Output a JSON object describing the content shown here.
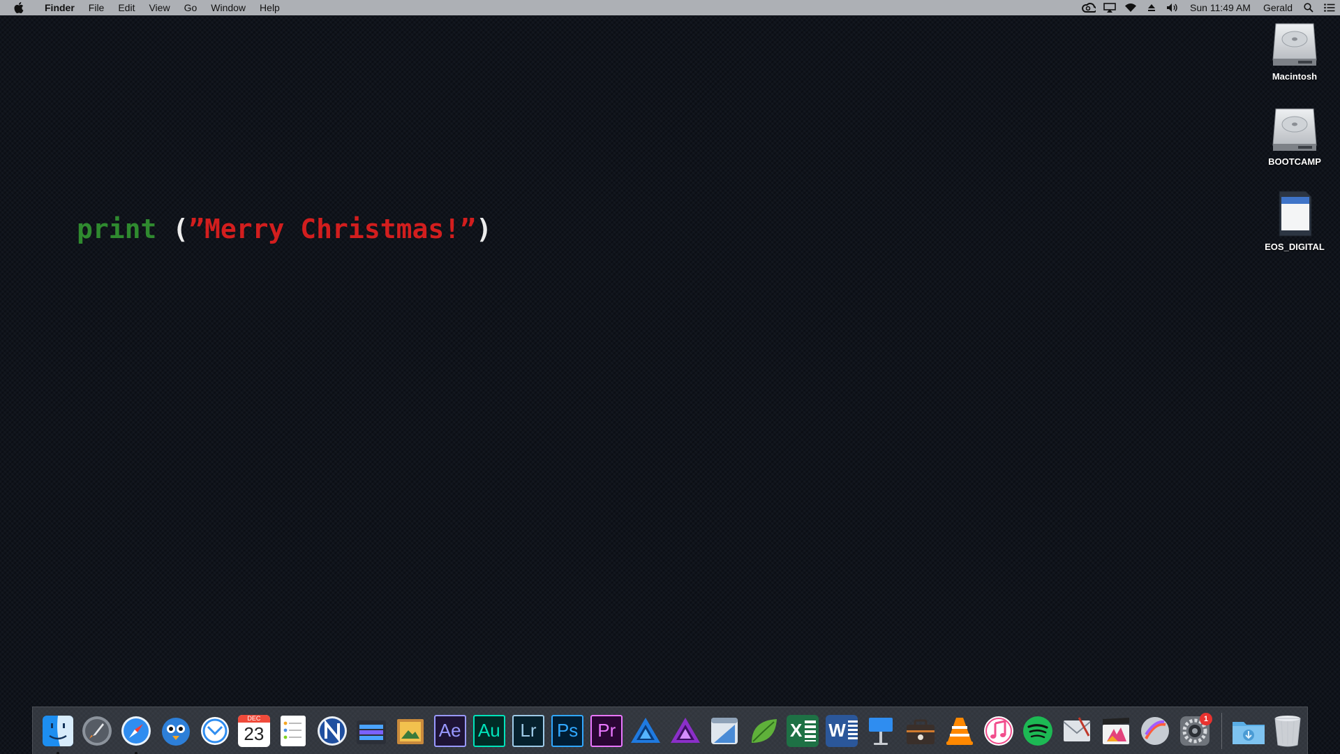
{
  "menubar": {
    "app": "Finder",
    "items": [
      "File",
      "Edit",
      "View",
      "Go",
      "Window",
      "Help"
    ],
    "clock": "Sun 11:49 AM",
    "user": "Gerald",
    "status_icons": [
      "creative-cloud-icon",
      "airplay-icon",
      "wifi-icon",
      "eject-icon",
      "volume-icon",
      "spotlight-icon",
      "notification-center-icon"
    ]
  },
  "desktop": {
    "code": {
      "keyword": "print",
      "open": " (",
      "string": "”Merry Christmas!”",
      "close": ")"
    },
    "icons": [
      {
        "label": "Macintosh",
        "type": "hard-drive-icon"
      },
      {
        "label": "BOOTCAMP",
        "type": "hard-drive-icon"
      },
      {
        "label": "EOS_DIGITAL",
        "type": "sd-card-icon"
      }
    ]
  },
  "dock": {
    "calendar": {
      "month": "DEC",
      "day": "23"
    },
    "adobe": {
      "ae": "Ae",
      "au": "Au",
      "lr": "Lr",
      "ps": "Ps",
      "pr": "Pr"
    },
    "excel_letter": "X",
    "word_letter": "W",
    "system_prefs_badge": "1",
    "colors": {
      "ae": "#9999ff",
      "au": "#00e4bb",
      "lr": "#31a8ff",
      "ps": "#31a8ff",
      "pr": "#ea77ff",
      "adobe_bg": "#1e1436"
    },
    "apps": [
      "finder-icon",
      "launchpad-icon",
      "safari-icon",
      "tweetbot-icon",
      "mail-icon",
      "calendar-icon",
      "reminders-icon",
      "nova-icon",
      "screenflow-icon",
      "preview-icon",
      "after-effects-icon",
      "audition-icon",
      "lightroom-icon",
      "photoshop-icon",
      "premiere-icon",
      "affinity-designer-icon",
      "affinity-photo-icon",
      "sketch-icon",
      "leaf-icon",
      "excel-icon",
      "word-icon",
      "keynote-icon",
      "toolbox-icon",
      "vlc-icon",
      "itunes-icon",
      "spotify-icon",
      "preview-mail-icon",
      "final-cut-icon",
      "motion-icon",
      "system-preferences-icon",
      "downloads-folder-icon",
      "trash-icon"
    ]
  }
}
